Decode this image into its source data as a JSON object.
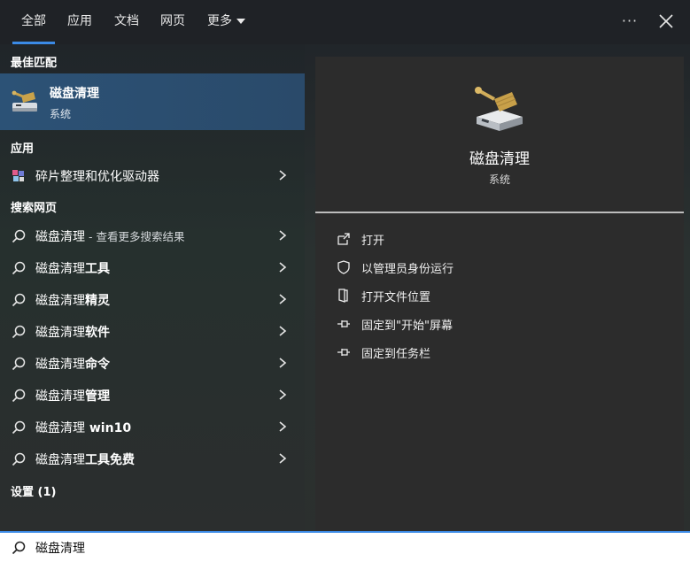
{
  "tabs": [
    {
      "label": "全部",
      "active": true
    },
    {
      "label": "应用"
    },
    {
      "label": "文档"
    },
    {
      "label": "网页"
    },
    {
      "label": "更多"
    }
  ],
  "sections": {
    "best_match": "最佳匹配",
    "apps": "应用",
    "web": "搜索网页",
    "settings": "设置 (1)"
  },
  "best_match": {
    "title": "磁盘清理",
    "subtitle": "系统"
  },
  "apps": [
    {
      "label": "碎片整理和优化驱动器"
    }
  ],
  "web_results": [
    {
      "prefix": "磁盘清理",
      "suffix": " - 查看更多搜索结果"
    },
    {
      "prefix": "磁盘清理",
      "bold": "工具"
    },
    {
      "prefix": "磁盘清理",
      "bold": "精灵"
    },
    {
      "prefix": "磁盘清理",
      "bold": "软件"
    },
    {
      "prefix": "磁盘清理",
      "bold": "命令"
    },
    {
      "prefix": "磁盘清理",
      "bold": "管理"
    },
    {
      "prefix": "磁盘清理",
      "bold": " win10"
    },
    {
      "prefix": "磁盘清理",
      "bold": "工具免费"
    }
  ],
  "preview": {
    "title": "磁盘清理",
    "subtitle": "系统",
    "actions": [
      {
        "label": "打开",
        "icon": "open-icon"
      },
      {
        "label": "以管理员身份运行",
        "icon": "shield-icon"
      },
      {
        "label": "打开文件位置",
        "icon": "folder-icon"
      },
      {
        "label": "固定到\"开始\"屏幕",
        "icon": "pin-icon"
      },
      {
        "label": "固定到任务栏",
        "icon": "pin-icon"
      }
    ]
  },
  "search": {
    "value": "磁盘清理"
  },
  "colors": {
    "accent": "#3b8ae6",
    "selected": "#2c5276"
  }
}
